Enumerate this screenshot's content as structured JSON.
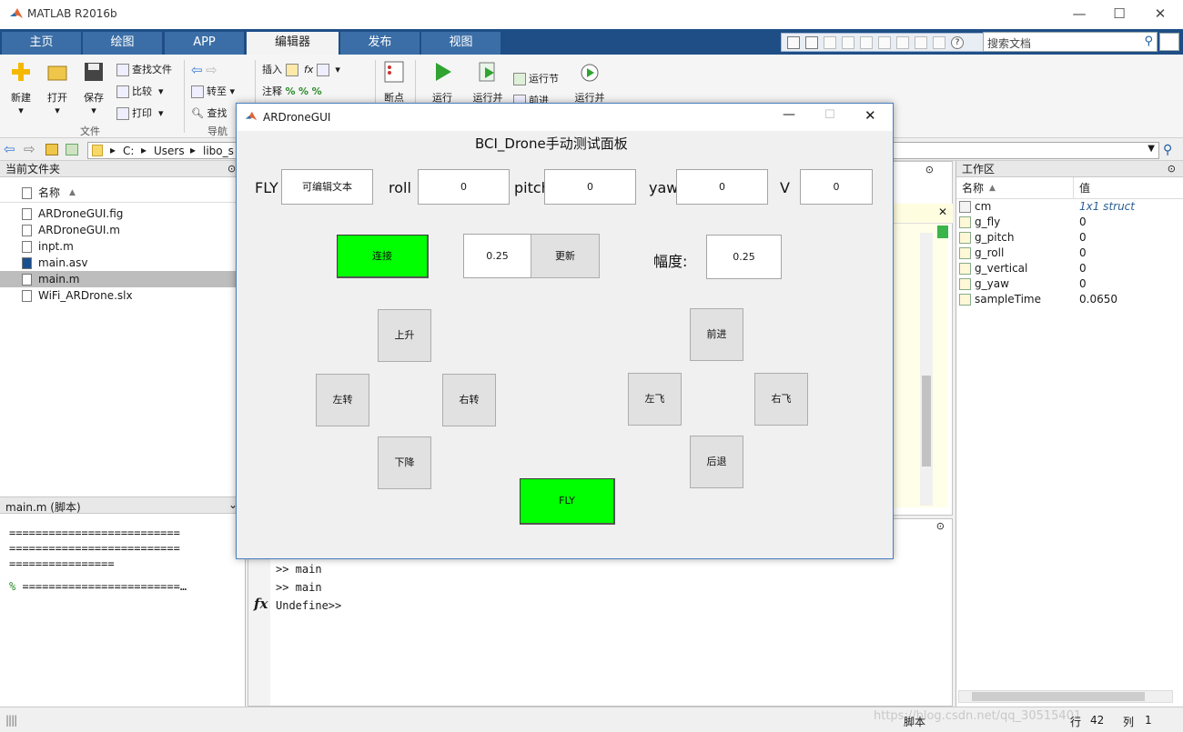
{
  "app": {
    "title": "MATLAB R2016b"
  },
  "tabs": [
    "主页",
    "绘图",
    "APP",
    "编辑器",
    "发布",
    "视图"
  ],
  "search": {
    "placeholder": "搜索文档"
  },
  "ribbon": {
    "file": {
      "new": "新建",
      "open": "打开",
      "save": "保存",
      "find_files": "查找文件",
      "compare": "比较",
      "print": "打印",
      "group": "文件"
    },
    "nav": {
      "goto": "转至",
      "find": "查找",
      "group": "导航"
    },
    "edit": {
      "insert": "插入",
      "comment": "注释",
      "fx": "fx"
    },
    "breakpoint": {
      "label": "断点"
    },
    "run": {
      "run": "运行",
      "run_advance": "运行并",
      "run_section": "运行节",
      "advance": "前进",
      "run_time": "运行并"
    }
  },
  "address": {
    "path": [
      "C:",
      "Users",
      "libo_s"
    ]
  },
  "left_panel": {
    "header": "当前文件夹",
    "col_name": "名称",
    "files": [
      "ARDroneGUI.fig",
      "ARDroneGUI.m",
      "inpt.m",
      "main.asv",
      "main.m",
      "WiFi_ARDrone.slx"
    ],
    "details_header": "main.m  (脚本)",
    "details_lines": [
      "==========================",
      "==========================",
      "================",
      "========================…"
    ]
  },
  "command": {
    "lines": [
      ">> main",
      ">> main",
      "Undefine>>"
    ],
    "fx": "fx"
  },
  "workspace": {
    "header": "工作区",
    "col_name": "名称",
    "col_value": "值",
    "vars": [
      {
        "name": "cm",
        "value": "1x1 struct"
      },
      {
        "name": "g_fly",
        "value": "0"
      },
      {
        "name": "g_pitch",
        "value": "0"
      },
      {
        "name": "g_roll",
        "value": "0"
      },
      {
        "name": "g_vertical",
        "value": "0"
      },
      {
        "name": "g_yaw",
        "value": "0"
      },
      {
        "name": "sampleTime",
        "value": "0.0650"
      }
    ]
  },
  "status": {
    "mode": "脚本",
    "row_label": "行",
    "row": "42",
    "col_label": "列",
    "col": "1",
    "watermark": "https://blog.csdn.net/qq_30515401"
  },
  "dialog": {
    "title": "ARDroneGUI",
    "heading": "BCI_Drone手动测试面板",
    "fly_label": "FLY",
    "fly_value": "可编辑文本",
    "roll_label": "roll",
    "roll_value": "0",
    "pitch_label": "pitch",
    "pitch_value": "0",
    "yaw_label": "yaw",
    "yaw_value": "0",
    "v_label": "V",
    "v_value": "0",
    "connect": "连接",
    "step_value": "0.25",
    "update": "更新",
    "amp_label": "幅度:",
    "amp_value": "0.25",
    "up": "上升",
    "down": "下降",
    "turn_left": "左转",
    "turn_right": "右转",
    "forward": "前进",
    "backward": "后退",
    "fly_left": "左飞",
    "fly_right": "右飞",
    "fly_button": "FLY",
    "green": "#00ff00"
  }
}
